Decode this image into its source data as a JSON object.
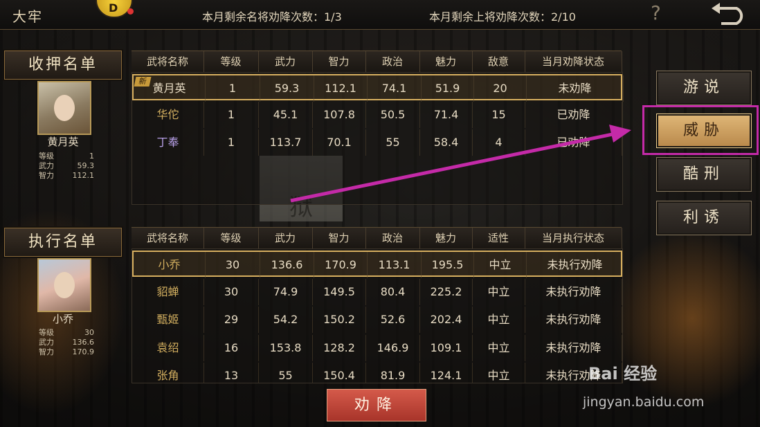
{
  "header": {
    "title": "大牢",
    "logo_text": "D",
    "named_general_count": "本月剩余名将劝降次数：1/3",
    "upper_general_count": "本月剩余上将劝降次数：2/10",
    "help_icon": "?",
    "back_icon": "back-arrow-icon"
  },
  "detained": {
    "label": "收押名单",
    "featured": {
      "name": "黄月英",
      "level_label": "等级",
      "level": "1",
      "force_label": "武力",
      "force": "59.3",
      "intel_label": "智力",
      "intel": "112.1"
    },
    "columns": [
      "武将名称",
      "等级",
      "武力",
      "智力",
      "政治",
      "魅力",
      "敌意",
      "当月劝降状态"
    ],
    "new_tag": "新",
    "rows": [
      {
        "name": "黄月英",
        "level": "1",
        "force": "59.3",
        "intel": "112.1",
        "politics": "74.1",
        "charm": "51.9",
        "hostility": "20",
        "status": "未劝降",
        "name_color": "#e8dcc4"
      },
      {
        "name": "华佗",
        "level": "1",
        "force": "45.1",
        "intel": "107.8",
        "politics": "50.5",
        "charm": "71.4",
        "hostility": "15",
        "status": "已劝降",
        "name_color": "#d4b060"
      },
      {
        "name": "丁奉",
        "level": "1",
        "force": "113.7",
        "intel": "70.1",
        "politics": "55",
        "charm": "58.4",
        "hostility": "4",
        "status": "已劝降",
        "name_color": "#b8a0e8"
      }
    ]
  },
  "executor": {
    "label": "执行名单",
    "featured": {
      "name": "小乔",
      "level_label": "等级",
      "level": "30",
      "force_label": "武力",
      "force": "136.6",
      "intel_label": "智力",
      "intel": "170.9"
    },
    "columns": [
      "武将名称",
      "等级",
      "武力",
      "智力",
      "政治",
      "魅力",
      "适性",
      "当月执行状态"
    ],
    "rows": [
      {
        "name": "小乔",
        "level": "30",
        "force": "136.6",
        "intel": "170.9",
        "politics": "113.1",
        "charm": "195.5",
        "aptitude": "中立",
        "status": "未执行劝降",
        "name_color": "#d4b060"
      },
      {
        "name": "貂蝉",
        "level": "30",
        "force": "74.9",
        "intel": "149.5",
        "politics": "80.4",
        "charm": "225.2",
        "aptitude": "中立",
        "status": "未执行劝降",
        "name_color": "#d4b060"
      },
      {
        "name": "甄姬",
        "level": "29",
        "force": "54.2",
        "intel": "150.2",
        "politics": "52.6",
        "charm": "202.4",
        "aptitude": "中立",
        "status": "未执行劝降",
        "name_color": "#d4b060"
      },
      {
        "name": "袁绍",
        "level": "16",
        "force": "153.8",
        "intel": "128.2",
        "politics": "146.9",
        "charm": "109.1",
        "aptitude": "中立",
        "status": "未执行劝降",
        "name_color": "#d4b060"
      },
      {
        "name": "张角",
        "level": "13",
        "force": "55",
        "intel": "150.4",
        "politics": "81.9",
        "charm": "124.1",
        "aptitude": "中立",
        "status": "未执行劝降",
        "name_color": "#d4b060"
      }
    ]
  },
  "actions": {
    "persuade": "游说",
    "threaten": "威胁",
    "torture": "酷刑",
    "entice": "利诱"
  },
  "surrender_button": "劝降",
  "banner_text": "狱",
  "watermark": {
    "brand": "Bai 经验",
    "url": "jingyan.baidu.com"
  },
  "colors": {
    "highlight": "#c42aa8",
    "accent_gold": "#d8b060",
    "red_button": "#c0463a"
  }
}
